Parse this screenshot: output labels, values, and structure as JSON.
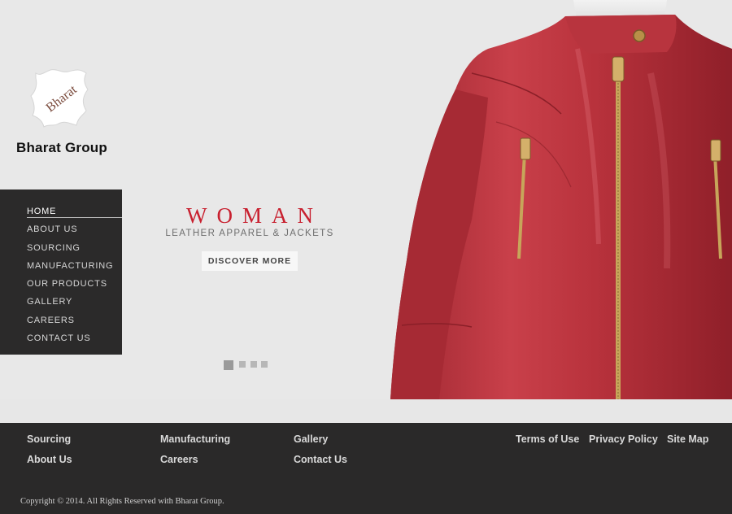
{
  "brand": {
    "logo_text": "Bharat",
    "name": "Bharat Group"
  },
  "nav": {
    "items": [
      {
        "label": "HOME",
        "active": true
      },
      {
        "label": "ABOUT US"
      },
      {
        "label": "SOURCING"
      },
      {
        "label": "MANUFACTURING"
      },
      {
        "label": "OUR PRODUCTS"
      },
      {
        "label": "GALLERY"
      },
      {
        "label": "CAREERS"
      },
      {
        "label": "CONTACT US"
      }
    ]
  },
  "promo": {
    "title": "WOMAN",
    "subtitle": "LEATHER APPAREL & JACKETS",
    "button": "DISCOVER MORE"
  },
  "slider": {
    "count": 4,
    "active_index": 0
  },
  "footer": {
    "col1": [
      "Sourcing",
      "About Us"
    ],
    "col2": [
      "Manufacturing",
      "Careers"
    ],
    "col3": [
      "Gallery",
      "Contact Us"
    ],
    "legal": [
      "Terms of Use",
      "Privacy Policy",
      "Site Map"
    ],
    "copyright": "Copyright © 2014. All Rights Reserved with Bharat Group."
  },
  "colors": {
    "accent_red": "#c8202f",
    "nav_bg": "#2b2a2a",
    "page_bg": "#e8e8e8",
    "jacket_red": "#c0393f"
  },
  "hero_image": "red-leather-jacket"
}
